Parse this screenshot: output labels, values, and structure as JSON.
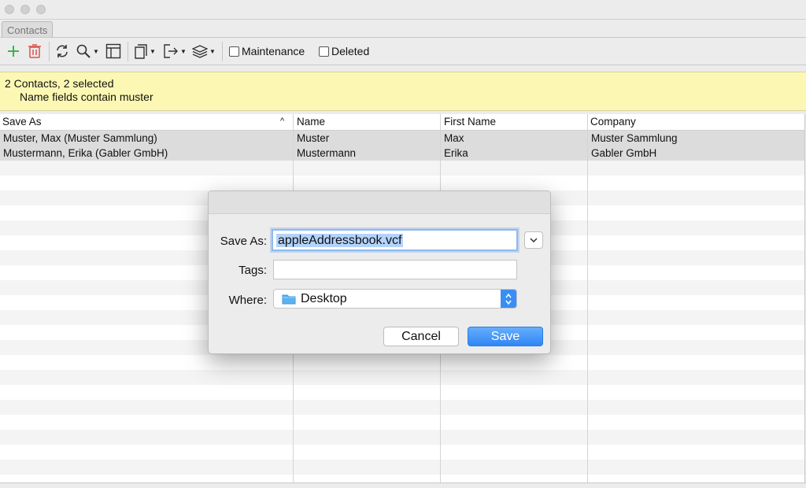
{
  "tab": {
    "label": "Contacts"
  },
  "toolbar": {
    "maintenance_label": "Maintenance",
    "deleted_label": "Deleted",
    "icons": [
      "add-icon",
      "trash-icon",
      "refresh-icon",
      "search-icon",
      "layout-icon",
      "copy-icon",
      "export-icon",
      "layers-icon"
    ]
  },
  "info": {
    "line1": "2 Contacts, 2 selected",
    "line2": "Name fields contain muster"
  },
  "table": {
    "columns": [
      "Save As",
      "Name",
      "First Name",
      "Company"
    ],
    "rows": [
      [
        "Muster, Max (Muster Sammlung)",
        "Muster",
        "Max",
        "Muster Sammlung"
      ],
      [
        "Mustermann, Erika (Gabler GmbH)",
        "Mustermann",
        "Erika",
        "Gabler GmbH"
      ]
    ]
  },
  "dialog": {
    "save_as_label": "Save As:",
    "filename": "appleAddressbook.vcf",
    "tags_label": "Tags:",
    "tags_value": "",
    "where_label": "Where:",
    "where_value": "Desktop",
    "cancel_label": "Cancel",
    "save_label": "Save"
  },
  "colors": {
    "accent": "#3a8ef3",
    "info_background": "#fcf8b3",
    "add": "#3cb44b",
    "delete": "#d9534f"
  }
}
